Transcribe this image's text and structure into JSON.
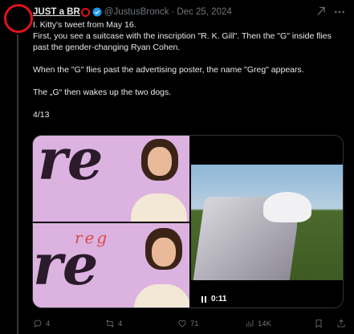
{
  "post": {
    "display_name": "JUST a BR",
    "handle": "@JustusBronck",
    "separator": "·",
    "date": "Dec 25, 2024",
    "body": [
      "I. Kitty's tweet from May 16.",
      "First, you see a suitcase with the inscription \"R. K. Gill\". Then the \"G\" inside flies past the gender-changing Ryan Cohen.",
      "",
      "When the \"G\" flies past the advertising poster, the name \"Greg\" appears.",
      "",
      "The „G“ then wakes up the two dogs.",
      "",
      "4/13"
    ]
  },
  "media": {
    "left_video": {
      "top_letters": "re",
      "bottom_letters": "re",
      "overlay_text": "reg"
    },
    "right_video": {
      "timestamp": "0:11"
    }
  },
  "actions": {
    "replies": "4",
    "reposts": "4",
    "likes": "71",
    "views": "14K"
  },
  "colors": {
    "accent_red": "#e0131a",
    "verified_blue": "#1d9bf0",
    "muted_text": "#71767b"
  }
}
